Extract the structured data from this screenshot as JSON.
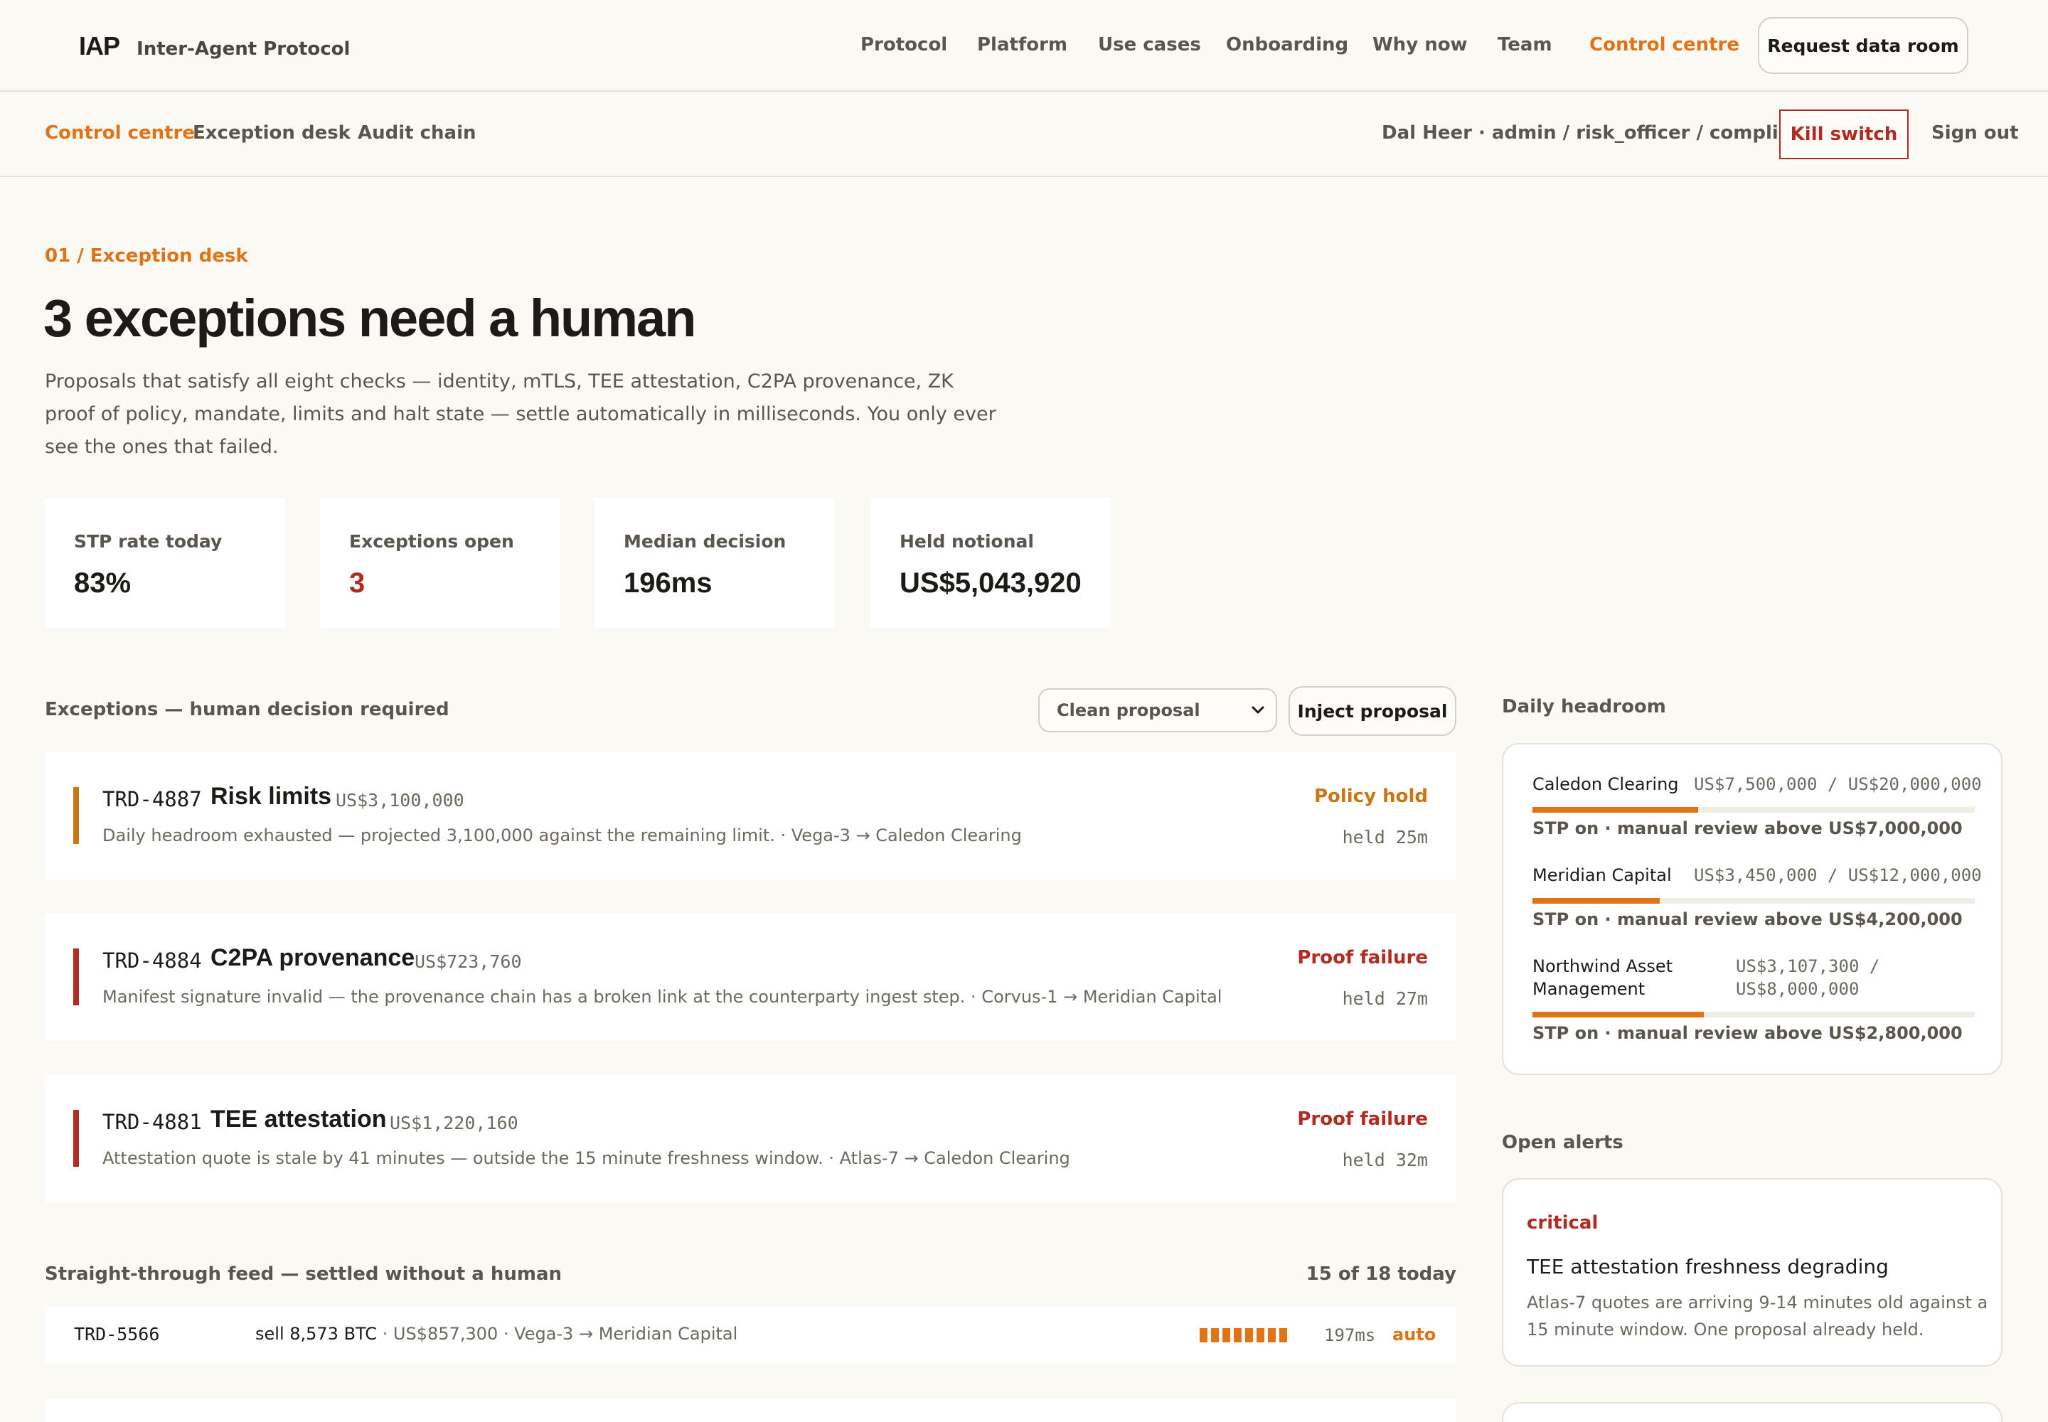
{
  "brand": {
    "mark": "IAP",
    "name": "Inter-Agent Protocol"
  },
  "nav": {
    "links": [
      "Protocol",
      "Platform",
      "Use cases",
      "Onboarding",
      "Why now",
      "Team",
      "Control centre"
    ],
    "cta": "Request data room"
  },
  "subnav": {
    "links": [
      "Control centre",
      "Exception desk",
      "Audit chain"
    ],
    "user": "Dal Heer · admin / risk_officer / compliance",
    "kill_switch": "Kill switch",
    "sign_out": "Sign out"
  },
  "hero": {
    "eyebrow": "01 / Exception desk",
    "headline": "3 exceptions need a human",
    "lede": "Proposals that satisfy all eight checks — identity, mTLS, TEE attestation, C2PA provenance, ZK proof of policy, mandate, limits and halt state — settle automatically in milliseconds. You only ever see the ones that failed."
  },
  "stats": [
    {
      "label": "STP rate today",
      "value": "83%"
    },
    {
      "label": "Exceptions open",
      "value": "3"
    },
    {
      "label": "Median decision",
      "value": "196ms"
    },
    {
      "label": "Held notional",
      "value": "US$5,043,920"
    }
  ],
  "exceptions": {
    "title": "Exceptions — human decision required",
    "select_value": "Clean proposal",
    "inject_label": "Inject proposal",
    "items": [
      {
        "id": "TRD-4887",
        "title": "Risk limits",
        "amount": "US$3,100,000",
        "desc": "Daily headroom exhausted — projected 3,100,000 against the remaining limit. · Vega-3 → Caledon Clearing",
        "status": "Policy hold",
        "held": "held 25m",
        "color": "#c87616"
      },
      {
        "id": "TRD-4884",
        "title": "C2PA provenance",
        "amount": "US$723,760",
        "desc": "Manifest signature invalid — the provenance chain has a broken link at the counterparty ingest step. · Corvus-1 → Meridian Capital",
        "status": "Proof failure",
        "held": "held 27m",
        "color": "#b32a21"
      },
      {
        "id": "TRD-4881",
        "title": "TEE attestation",
        "amount": "US$1,220,160",
        "desc": "Attestation quote is stale by 41 minutes — outside the 15 minute freshness window. · Atlas-7 → Caledon Clearing",
        "status": "Proof failure",
        "held": "held 32m",
        "color": "#b32a21"
      }
    ]
  },
  "feed": {
    "title": "Straight-through feed — settled without a human",
    "count": "15 of 18 today",
    "rows": [
      {
        "id": "TRD-5566",
        "trade": "sell 8,573 BTC",
        "rest": " · US$857,300 · Vega-3 → Meridian Capital",
        "ms": "197ms",
        "mode": "auto"
      }
    ]
  },
  "headroom": {
    "title": "Daily headroom",
    "items": [
      {
        "name": "Caledon Clearing",
        "used": "US$7,500,000",
        "limit": "US$20,000,000",
        "fraction": 0.375,
        "note": "STP on · manual review above US$7,000,000"
      },
      {
        "name": "Meridian Capital",
        "used": "US$3,450,000",
        "limit": "US$12,000,000",
        "fraction": 0.2875,
        "note": "STP on · manual review above US$4,200,000"
      },
      {
        "name": "Northwind Asset Management",
        "used": "US$3,107,300",
        "limit": "US$8,000,000",
        "fraction": 0.388,
        "note": "STP on · manual review above US$2,800,000"
      }
    ]
  },
  "alerts": {
    "title": "Open alerts",
    "items": [
      {
        "severity": "critical",
        "title": "TEE attestation freshness degrading",
        "desc": "Atlas-7 quotes are arriving 9-14 minutes old against a 15 minute window. One proposal already held."
      }
    ]
  },
  "colors": {
    "accent": "#e07316",
    "danger": "#b32a21",
    "hold": "#c87616",
    "background": "#fbf9f4"
  }
}
